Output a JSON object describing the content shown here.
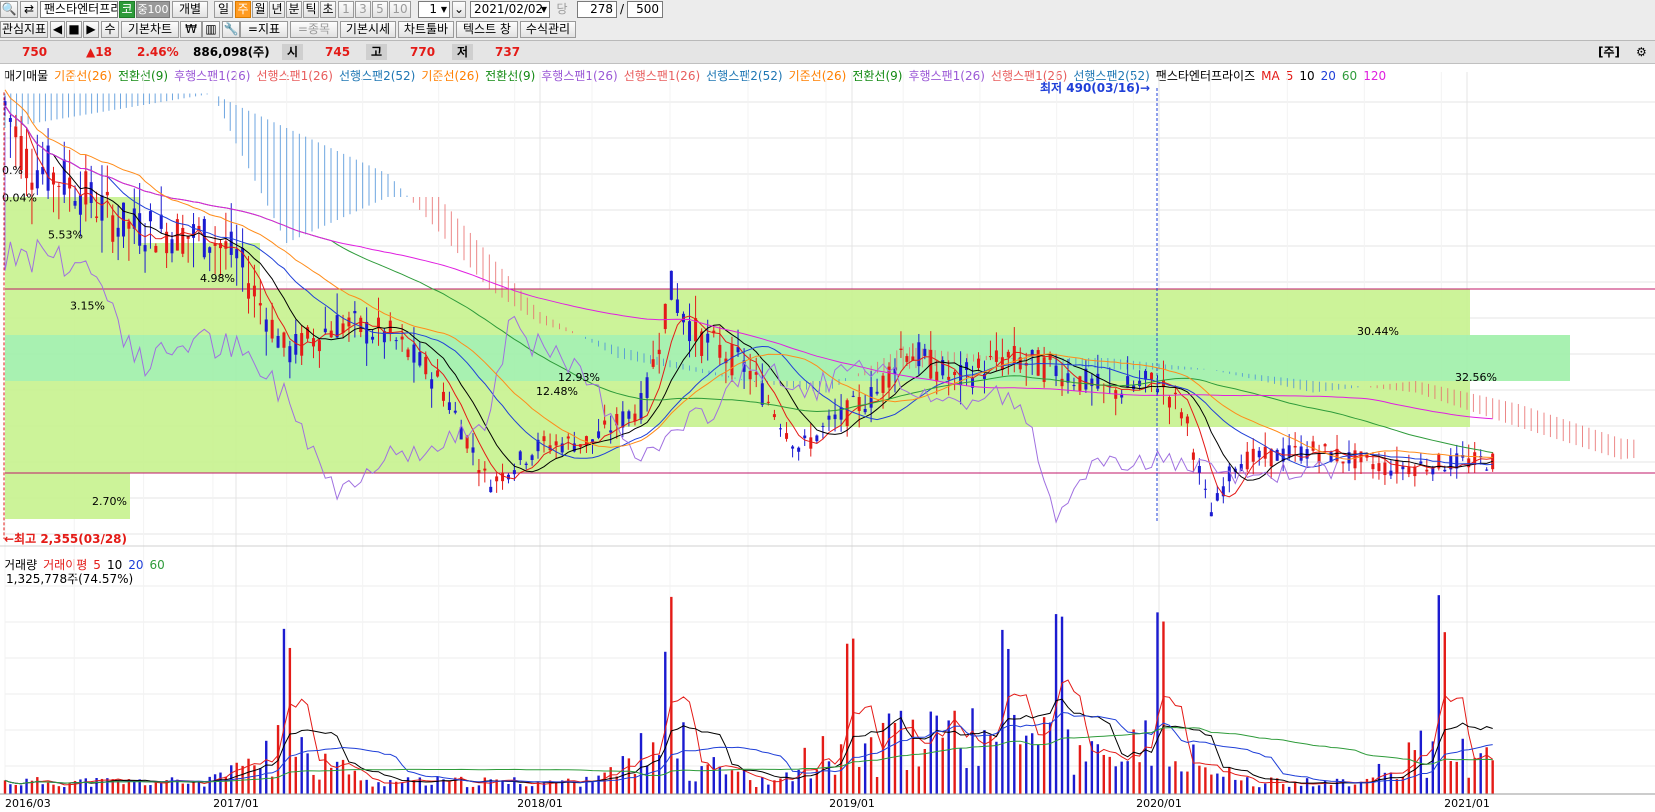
{
  "toolbar": {
    "stock_name": "팬스타엔터프리",
    "badge_ko": "코",
    "badge_jung": "중100",
    "period_buttons": [
      "개별",
      "일",
      "주",
      "월",
      "년",
      "분",
      "틱",
      "초"
    ],
    "active_period": "주",
    "interval_buttons": [
      "1",
      "3",
      "5",
      "10"
    ],
    "interval_value": "1",
    "date": "2021/02/02",
    "count_label": "당",
    "count_value": "278",
    "slash": "/",
    "total_value": "500",
    "row2": [
      "관심지표",
      "◀",
      "■",
      "▶",
      "수",
      "기본차트",
      "₩",
      "=지표",
      "=종목",
      "기본시세",
      "차트툴바",
      "텍스트 창",
      "수식관리"
    ]
  },
  "pricebar": {
    "price": "750",
    "change": "▲18",
    "rate": "2.46%",
    "volume": "886,098(주)",
    "open_label": "시",
    "open": "745",
    "high_label": "고",
    "high": "770",
    "low_label": "저",
    "low": "737",
    "unit": "[주]"
  },
  "price_legend": [
    {
      "text": "매기매물",
      "color": "#000000"
    },
    {
      "text": "기준선(26)",
      "color": "#ff7f00"
    },
    {
      "text": "전환선(9)",
      "color": "#138a13"
    },
    {
      "text": "후행스팬1(26)",
      "color": "#9b59d6"
    },
    {
      "text": "선행스팬1(26)",
      "color": "#e85d5d"
    },
    {
      "text": "선행스팬2(52)",
      "color": "#1f77b4"
    },
    {
      "text": "기준선(26)",
      "color": "#ff7f00"
    },
    {
      "text": "전환선(9)",
      "color": "#138a13"
    },
    {
      "text": "후행스팬1(26)",
      "color": "#9b59d6"
    },
    {
      "text": "선행스팬1(26)",
      "color": "#e85d5d"
    },
    {
      "text": "선행스팬2(52)",
      "color": "#1f77b4"
    },
    {
      "text": "기준선(26)",
      "color": "#ff7f00"
    },
    {
      "text": "전환선(9)",
      "color": "#138a13"
    },
    {
      "text": "후행스팬1(26)",
      "color": "#9b59d6"
    },
    {
      "text": "선행스팬1(26)",
      "color": "#e85d5d"
    },
    {
      "text": "선행스팬2(52)",
      "color": "#1f77b4"
    },
    {
      "text": "팬스타엔터프라이즈",
      "color": "#000000"
    },
    {
      "text": "MA",
      "color": "#e41b17"
    },
    {
      "text": "5",
      "color": "#e41b17"
    },
    {
      "text": "10",
      "color": "#000000"
    },
    {
      "text": "20",
      "color": "#1f3fd8"
    },
    {
      "text": "60",
      "color": "#2e9b3a"
    },
    {
      "text": "120",
      "color": "#e020e0"
    }
  ],
  "volume_legend": [
    {
      "text": "거래량",
      "color": "#000000"
    },
    {
      "text": "거래이평",
      "color": "#e41b17"
    },
    {
      "text": "5",
      "color": "#e41b17"
    },
    {
      "text": "10",
      "color": "#000000"
    },
    {
      "text": "20",
      "color": "#1f3fd8"
    },
    {
      "text": "60",
      "color": "#2e9b3a"
    }
  ],
  "volume_value": "1,325,778주(74.57%)",
  "annotations": {
    "max": "←최고 2,355(03/28)",
    "min": "최저 490(03/16)→",
    "pcts": [
      "0.%",
      "0.04%",
      "5.53%",
      "4.98%",
      "3.15%",
      "2.70%",
      "12.93%",
      "12.48%",
      "30.44%",
      "32.56%"
    ]
  },
  "colors": {
    "up": "#e41b17",
    "down": "#1b1bd0",
    "cloud_green": "#c6f28e",
    "cloud_green_strong": "#9ef0a8"
  },
  "chart_data": [
    {
      "type": "candlestick",
      "x_tick_labels": [
        "2016/03",
        "2017/01",
        "2018/01",
        "2019/01",
        "2020/01",
        "2021/01"
      ],
      "last": {
        "open": 745,
        "high": 770,
        "low": 737,
        "close": 750,
        "volume": 886098
      },
      "high_marker": {
        "value": 2355,
        "date": "03/28"
      },
      "low_marker": {
        "value": 490,
        "date": "03/16"
      },
      "close_path": [
        [
          "2016/03",
          2300
        ],
        [
          "2016/04",
          2050
        ],
        [
          "2016/06",
          1950
        ],
        [
          "2016/08",
          1780
        ],
        [
          "2016/10",
          1750
        ],
        [
          "2016/12",
          1720
        ],
        [
          "2017/01",
          1640
        ],
        [
          "2017/03",
          1220
        ],
        [
          "2017/05",
          1350
        ],
        [
          "2017/07",
          1300
        ],
        [
          "2017/09",
          1100
        ],
        [
          "2017/11",
          650
        ],
        [
          "2018/01",
          820
        ],
        [
          "2018/03",
          840
        ],
        [
          "2018/05",
          1000
        ],
        [
          "2018/06",
          1500
        ],
        [
          "2018/07",
          1300
        ],
        [
          "2018/09",
          1150
        ],
        [
          "2018/11",
          800
        ],
        [
          "2018/12",
          900
        ],
        [
          "2019/02",
          1050
        ],
        [
          "2019/03",
          1250
        ],
        [
          "2019/05",
          1100
        ],
        [
          "2019/07",
          1200
        ],
        [
          "2019/09",
          1150
        ],
        [
          "2019/11",
          1050
        ],
        [
          "2020/01",
          1100
        ],
        [
          "2020/02",
          950
        ],
        [
          "2020/03",
          520
        ],
        [
          "2020/04",
          750
        ],
        [
          "2020/07",
          800
        ],
        [
          "2020/10",
          720
        ],
        [
          "2021/01",
          750
        ]
      ]
    },
    {
      "type": "bar",
      "name": "거래량",
      "x_tick_labels": [
        "2016/03",
        "2017/01",
        "2018/01",
        "2019/01",
        "2020/01",
        "2021/01"
      ],
      "peak_dates": [
        "2017/03",
        "2018/06",
        "2019/01",
        "2019/07",
        "2019/09",
        "2020/01",
        "2020/12"
      ]
    }
  ]
}
